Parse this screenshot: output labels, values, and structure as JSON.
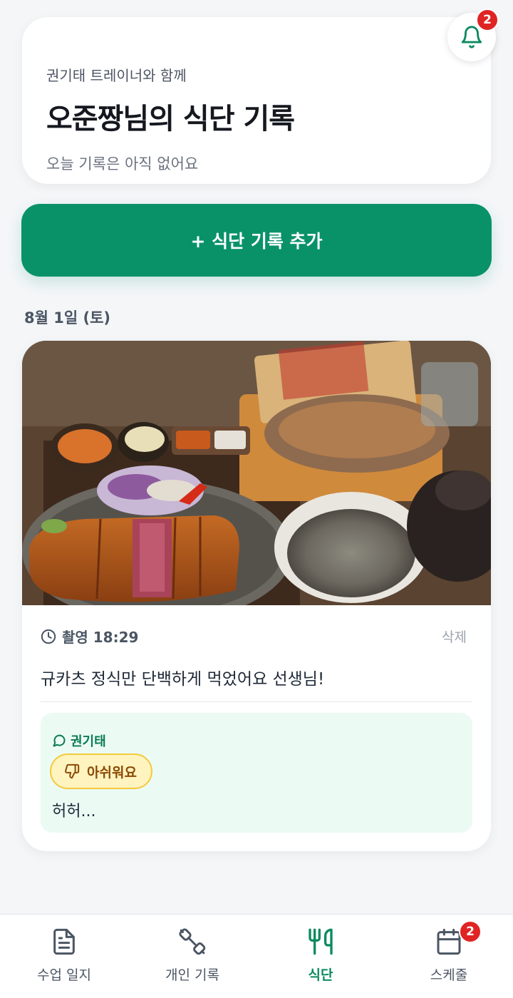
{
  "header": {
    "subtitle": "권기태 트레이너와 함께",
    "title": "오준짱님의 식단 기록",
    "status": "오늘 기록은 아직 없어요",
    "notifications": {
      "icon": "bell-icon",
      "count": "2"
    }
  },
  "add_button": {
    "label": "+ 식단 기록 추가"
  },
  "meals": [
    {
      "date": "8월 1일 (토)",
      "photo": "tonkatsu-meal-photo",
      "time": "촬영 18:29",
      "delete_label": "삭제",
      "memo": "규카츠 정식만 단백하게 먹었어요 선생님!",
      "feedback": {
        "author": "권기태",
        "reaction_label": "아쉬워요",
        "reaction_icon": "thumbs-down-icon",
        "text": "허허..."
      }
    }
  ],
  "tabs": [
    {
      "label": "수업 일지",
      "icon": "document-icon",
      "active": false
    },
    {
      "label": "개인 기록",
      "icon": "dumbbell-icon",
      "active": false
    },
    {
      "label": "식단",
      "icon": "fork-knife-icon",
      "active": true
    },
    {
      "label": "스케줄",
      "icon": "calendar-icon",
      "active": false,
      "badge": "2"
    }
  ],
  "colors": {
    "accent": "#099268",
    "badge": "#e02424",
    "feedback_bg": "#ebfbf4",
    "reaction_bg": "#fff3bf"
  }
}
